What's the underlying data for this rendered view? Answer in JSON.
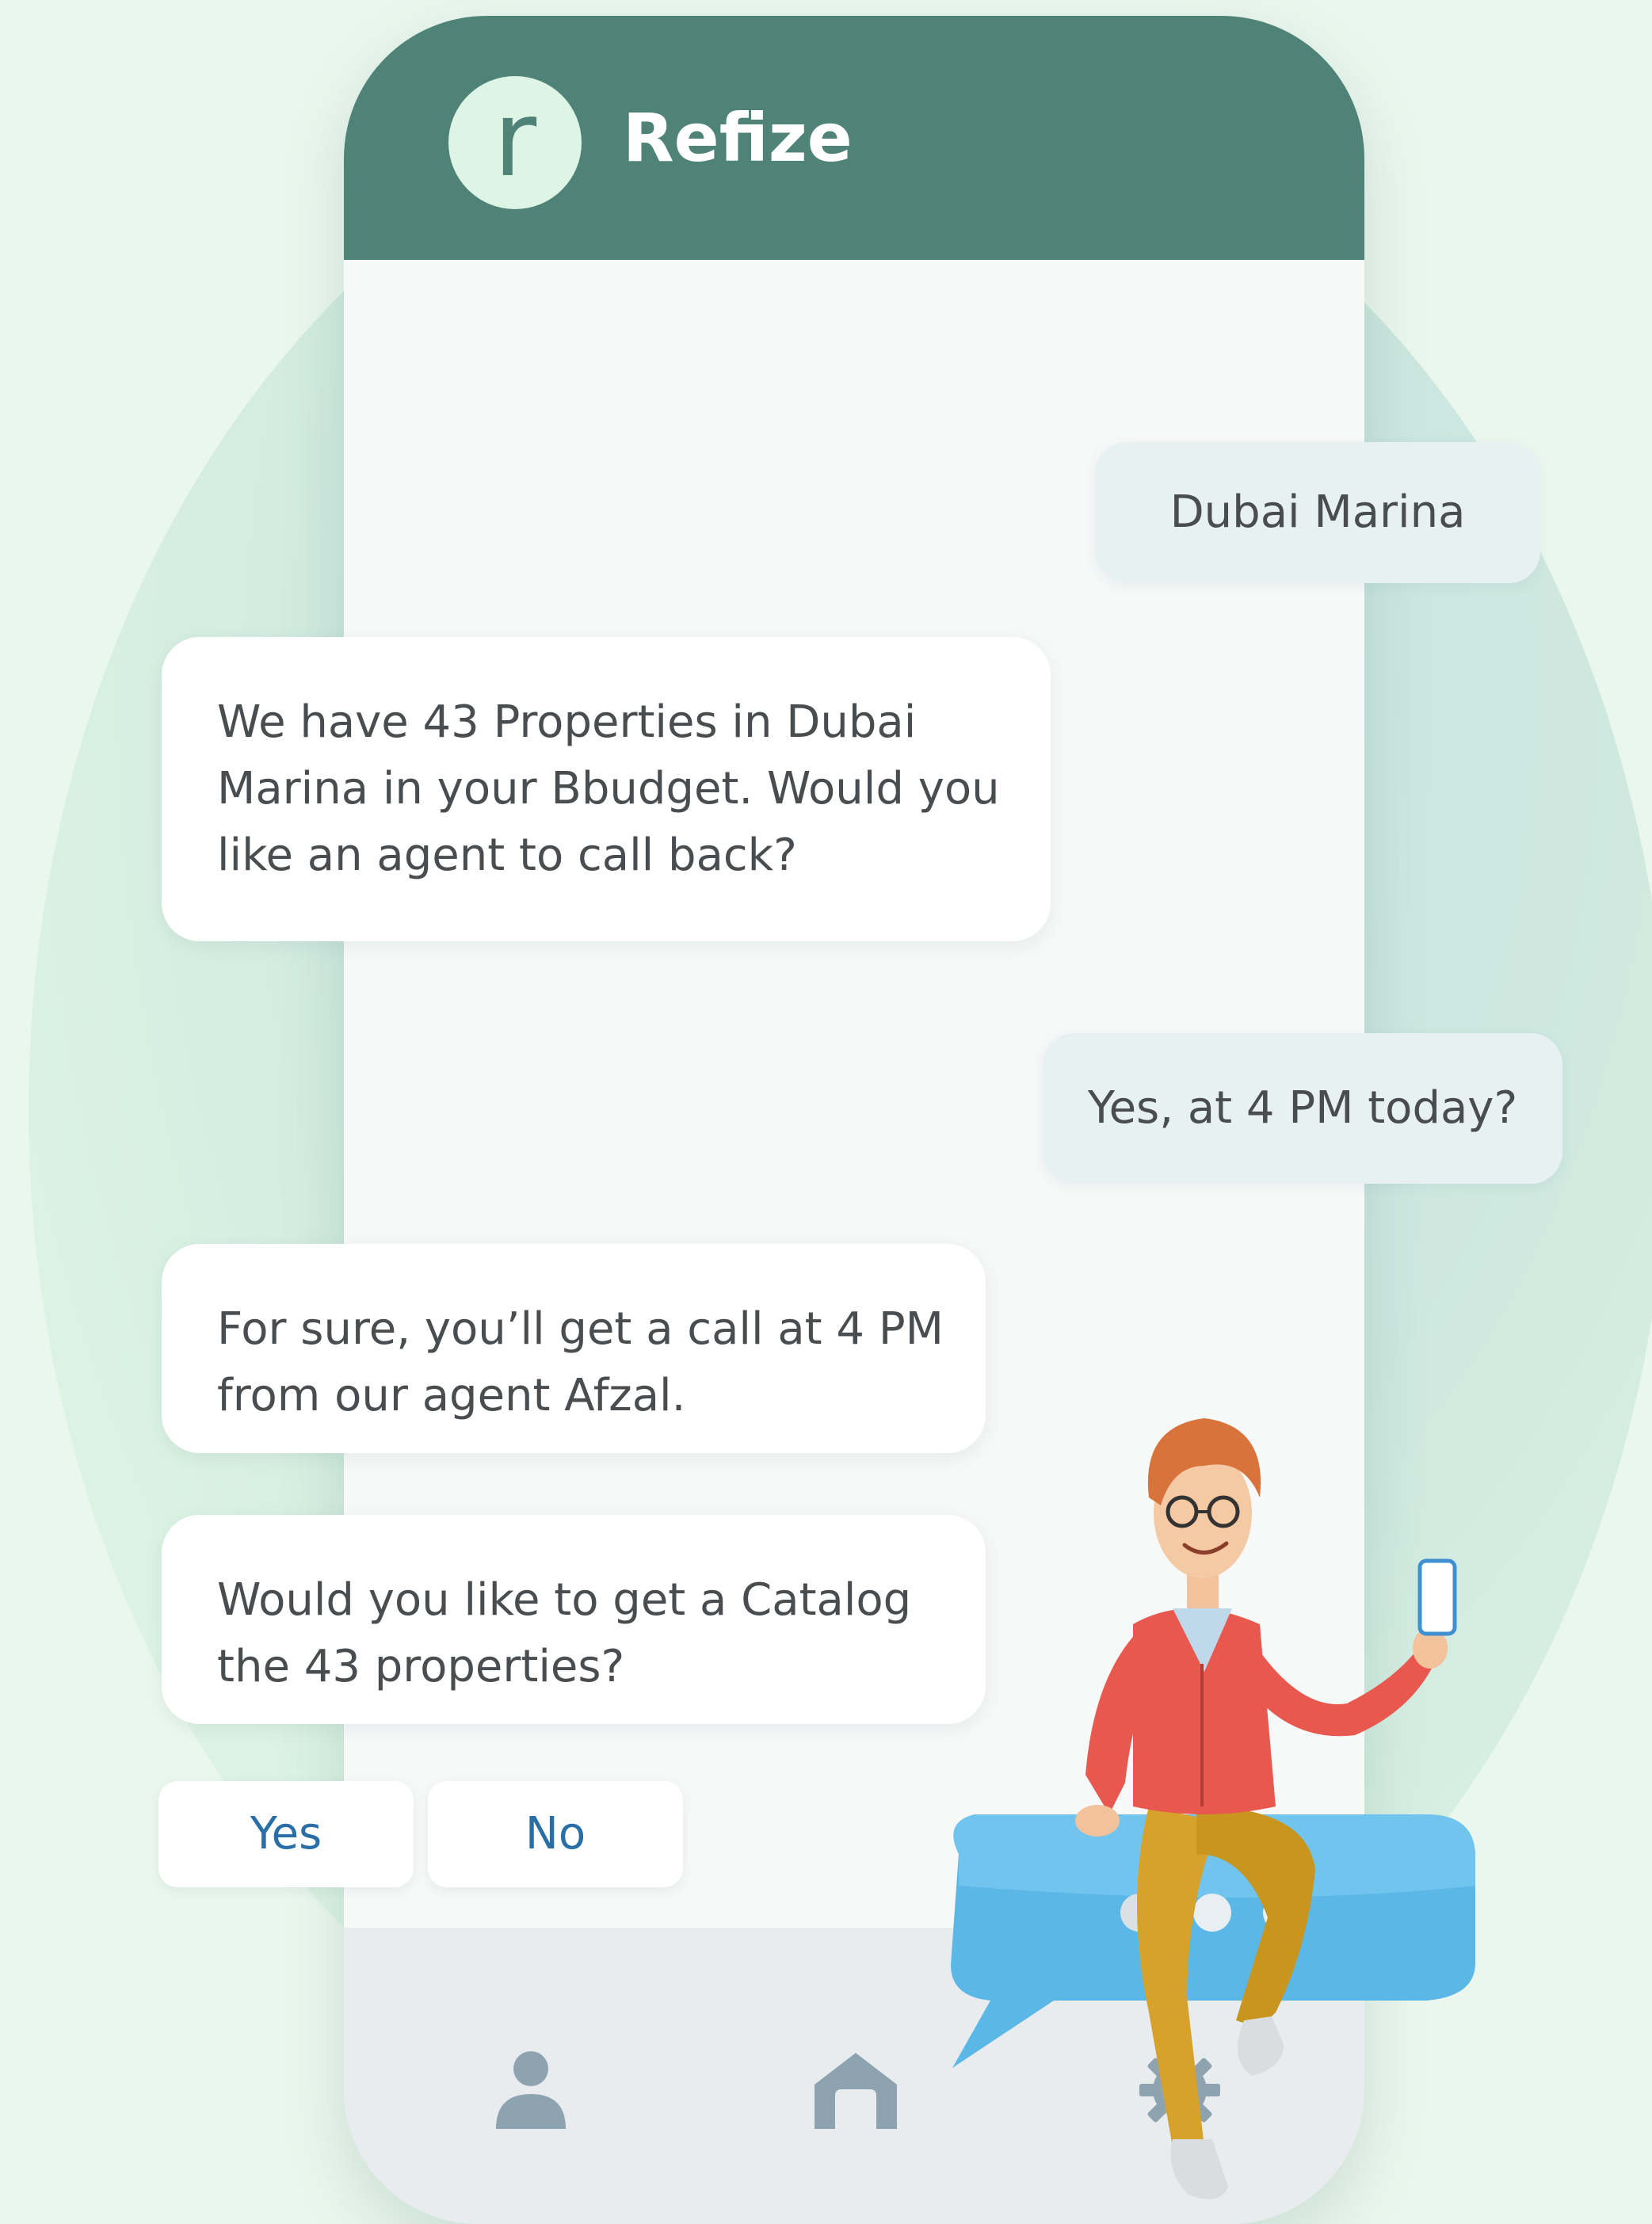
{
  "app": {
    "brand_letter": "r",
    "brand_name": "Refize"
  },
  "chat": {
    "messages": [
      {
        "sender": "user",
        "text": "Dubai Marina"
      },
      {
        "sender": "bot",
        "text": "We have 43 Properties in Dubai Marina in your Bbudget. Would you like an agent to call back?"
      },
      {
        "sender": "user",
        "text": "Yes, at 4 PM today?"
      },
      {
        "sender": "bot",
        "text": "For sure, you’ll get a call at 4 PM from our agent Afzal."
      },
      {
        "sender": "bot",
        "text": "Would you like to get a Catalog the 43 properties?"
      }
    ],
    "quick_replies": [
      "Yes",
      "No"
    ]
  },
  "nav": {
    "icons": [
      "person-icon",
      "home-icon",
      "gear-icon"
    ]
  },
  "colors": {
    "header": "#508378",
    "accent_text": "#2a6ea8",
    "background": "#eaf7ee",
    "user_bubble": "#e8f1f2",
    "tab_icon": "#8ea3b0"
  }
}
